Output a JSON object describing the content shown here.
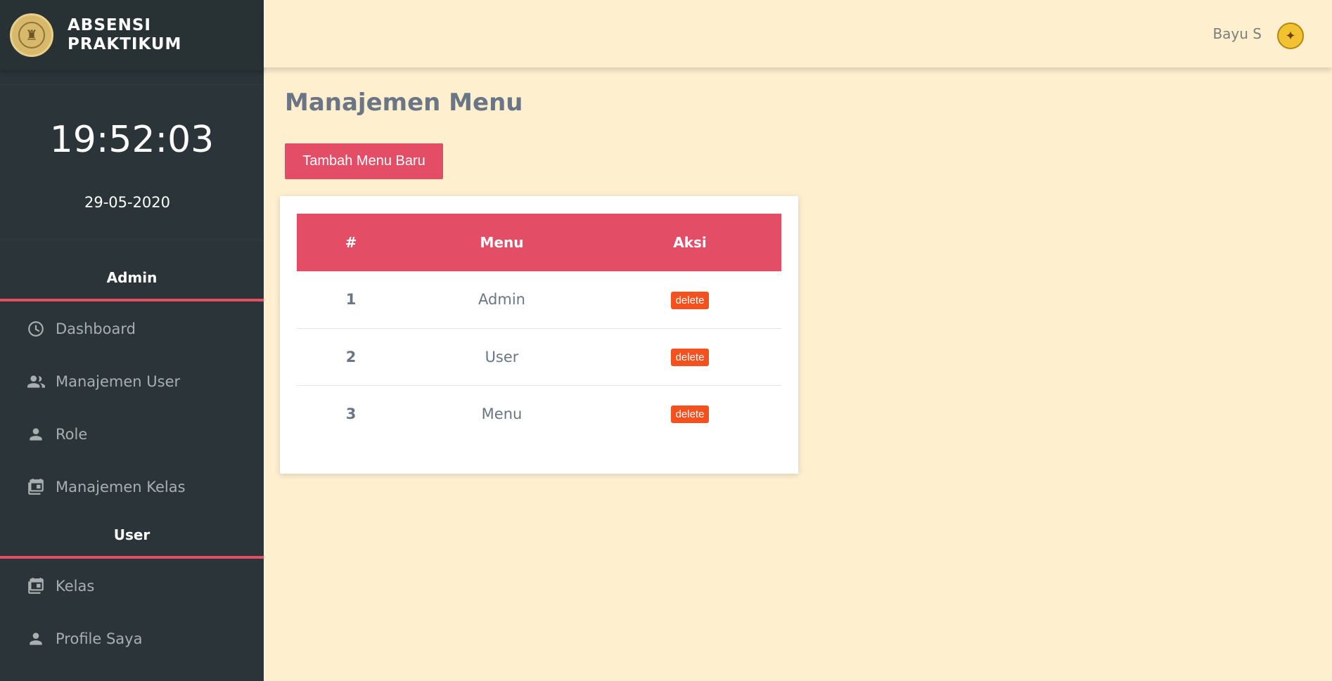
{
  "brand": {
    "line1": "ABSENSI",
    "line2": "PRAKTIKUM",
    "logo_icon": "university-seal-icon"
  },
  "clock": {
    "time": "19:52:03",
    "date": "29-05-2020"
  },
  "sidebar": {
    "sections": [
      {
        "heading": "Admin",
        "items": [
          {
            "label": "Dashboard",
            "icon": "dashboard-icon"
          },
          {
            "label": "Manajemen User",
            "icon": "users-icon"
          },
          {
            "label": "Role",
            "icon": "person-icon"
          },
          {
            "label": "Manajemen Kelas",
            "icon": "calendar-icon"
          }
        ]
      },
      {
        "heading": "User",
        "items": [
          {
            "label": "Kelas",
            "icon": "calendar-icon"
          },
          {
            "label": "Profile Saya",
            "icon": "person-icon"
          }
        ]
      }
    ]
  },
  "topbar": {
    "user_name": "Bayu S",
    "avatar_icon": "university-seal-icon"
  },
  "main": {
    "title": "Manajemen Menu",
    "add_button": "Tambah Menu Baru",
    "table": {
      "headers": [
        "#",
        "Menu",
        "Aksi"
      ],
      "rows": [
        {
          "no": "1",
          "menu": "Admin",
          "action": "delete"
        },
        {
          "no": "2",
          "menu": "User",
          "action": "delete"
        },
        {
          "no": "3",
          "menu": "Menu",
          "action": "delete"
        }
      ]
    }
  },
  "colors": {
    "sidebar_bg": "#2b3539",
    "accent": "#e44d66",
    "page_bg": "#feefcf",
    "delete_btn": "#f4511e"
  }
}
